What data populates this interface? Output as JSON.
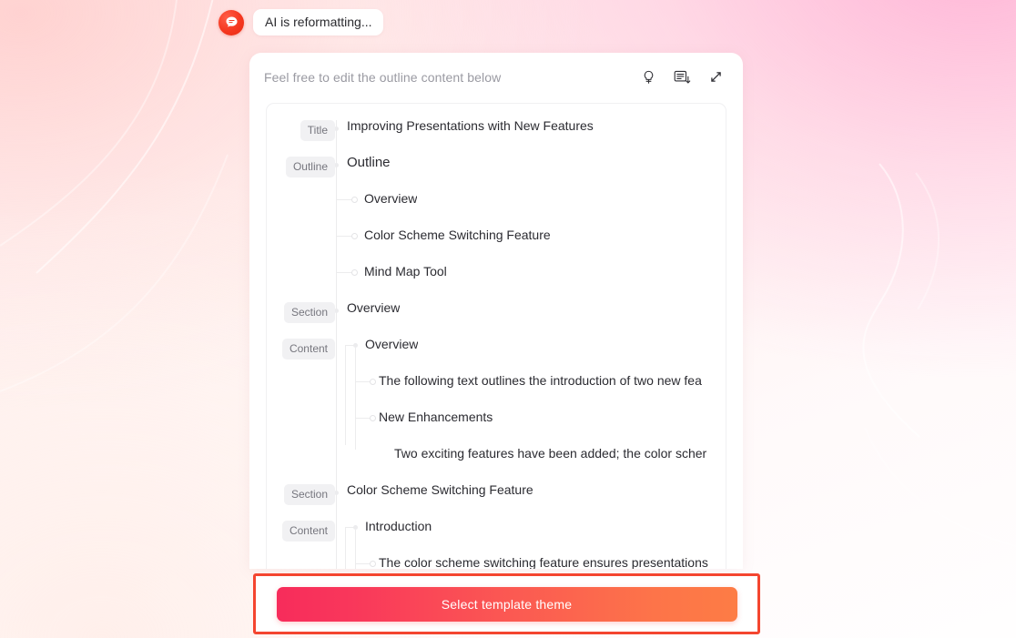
{
  "theme": {
    "accent_pink": "#f72c5b",
    "accent_orange": "#fd7c45",
    "highlight_border": "#f4452f",
    "avatar_red": "#f5371f",
    "tag_bg": "#f1f1f3",
    "tag_text": "#76767e",
    "background_top_right": "#ffb2d6",
    "background_bottom": "#ffffff"
  },
  "chat": {
    "avatar_icon": "chat-bubble-icon",
    "status_text": "AI is reformatting..."
  },
  "card": {
    "header": {
      "title": "Feel free to edit the outline content below",
      "icons": [
        {
          "name": "lightbulb-icon",
          "label": "Ideas"
        },
        {
          "name": "outline-collapse-icon",
          "label": "Collapse outline"
        },
        {
          "name": "expand-diagonal-icon",
          "label": "Expand"
        }
      ]
    },
    "outline": [
      {
        "tag": "Title",
        "text": "Improving Presentations with New Features",
        "level": 0,
        "style": "title"
      },
      {
        "tag": "Outline",
        "text": "Outline",
        "level": 0,
        "style": "h1"
      },
      {
        "tag": "",
        "text": "Overview",
        "level": 1,
        "style": "normal"
      },
      {
        "tag": "",
        "text": "Color Scheme Switching Feature",
        "level": 1,
        "style": "normal"
      },
      {
        "tag": "",
        "text": "Mind Map Tool",
        "level": 1,
        "style": "normal"
      },
      {
        "tag": "Section",
        "text": "Overview",
        "level": 0,
        "style": "normal"
      },
      {
        "tag": "Content",
        "text": "Overview",
        "level": 2,
        "style": "normal"
      },
      {
        "tag": "",
        "text": "The following text outlines the introduction of two new fea",
        "level": 3,
        "style": "normal"
      },
      {
        "tag": "",
        "text": "New Enhancements",
        "level": 3,
        "style": "normal"
      },
      {
        "tag": "",
        "text": "Two exciting features have been added; the color scher",
        "level": 4,
        "style": "normal"
      },
      {
        "tag": "Section",
        "text": "Color Scheme Switching Feature",
        "level": 0,
        "style": "normal"
      },
      {
        "tag": "Content",
        "text": "Introduction",
        "level": 2,
        "style": "normal"
      },
      {
        "tag": "",
        "text": "The color scheme switching feature ensures presentations",
        "level": 3,
        "style": "normal"
      }
    ]
  },
  "cta": {
    "button_label": "Select template theme"
  }
}
